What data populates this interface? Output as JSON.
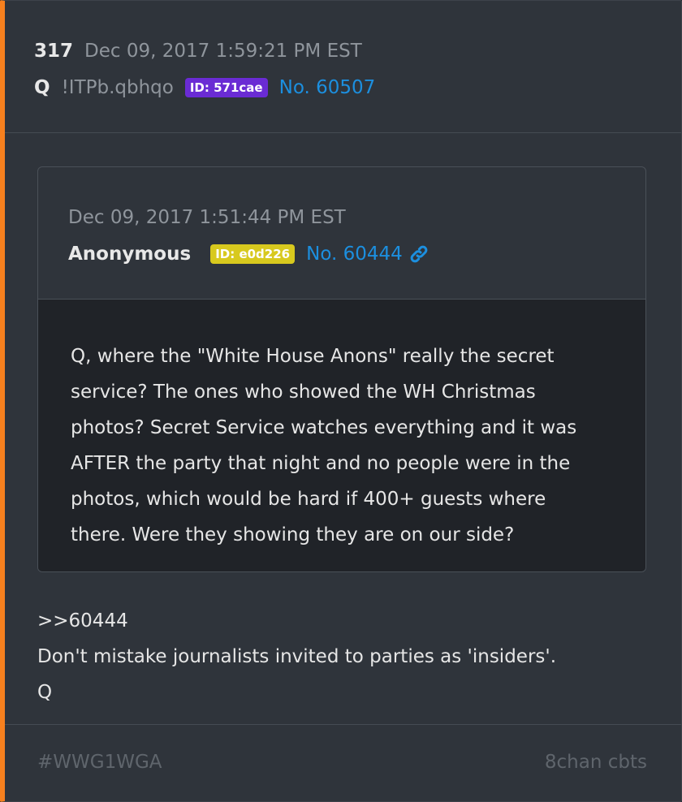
{
  "post": {
    "number": "317",
    "date": "Dec 09, 2017 1:59:21 PM EST",
    "author": "Q",
    "tripcode": "!ITPb.qbhqo",
    "id_label": "ID: 571cae",
    "post_no": "No. 60507"
  },
  "quoted": {
    "date": "Dec 09, 2017 1:51:44 PM EST",
    "author": "Anonymous",
    "id_label": "ID: e0d226",
    "post_no": "No. 60444",
    "text": "Q, where the \"White House Anons\" really the secret\nservice?  The ones who showed the WH Christmas\nphotos?  Secret Service watches everything and it was\nAFTER the party that night and no people were in the\nphotos, which would be hard if 400+ guests where\nthere.  Were they showing they are on our side?"
  },
  "reply": {
    "lines": [
      ">>60444",
      "Don't mistake journalists invited to parties as 'insiders'.",
      "Q"
    ]
  },
  "footer": {
    "hashtag": "#WWG1WGA",
    "source": "8chan cbts"
  },
  "colors": {
    "accent_bar": "#f7801e",
    "id_purple": "#6a2bd4",
    "id_yellow": "#d8c91e",
    "link_blue": "#1c8fdf"
  },
  "icons": {
    "permalink": "link-icon"
  }
}
